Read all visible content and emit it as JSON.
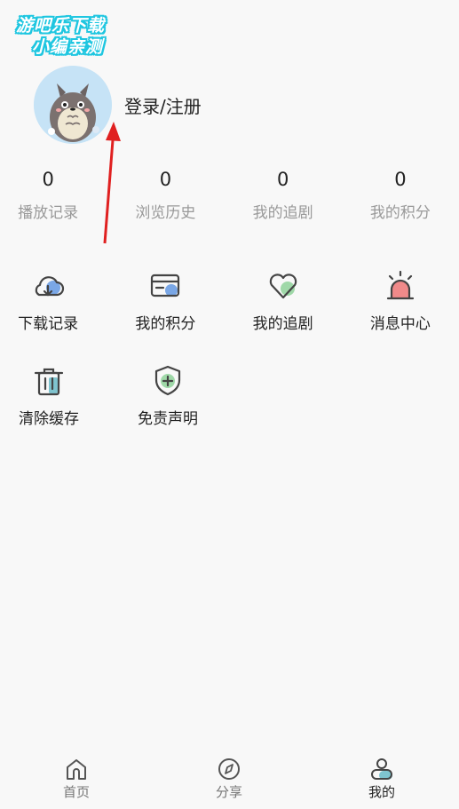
{
  "watermark": {
    "line1": "游吧乐下载",
    "line2": "小编亲测"
  },
  "profile": {
    "login_label": "登录/注册"
  },
  "stats": [
    {
      "value": "0",
      "label": "播放记录"
    },
    {
      "value": "0",
      "label": "浏览历史"
    },
    {
      "value": "0",
      "label": "我的追剧"
    },
    {
      "value": "0",
      "label": "我的积分"
    }
  ],
  "menu": [
    {
      "label": "下载记录",
      "icon": "cloud-download-icon"
    },
    {
      "label": "我的积分",
      "icon": "card-icon"
    },
    {
      "label": "我的追剧",
      "icon": "heart-icon"
    },
    {
      "label": "消息中心",
      "icon": "alarm-icon"
    },
    {
      "label": "清除缓存",
      "icon": "trash-icon"
    },
    {
      "label": "免责声明",
      "icon": "shield-icon"
    }
  ],
  "tabbar": [
    {
      "label": "首页",
      "icon": "home-icon"
    },
    {
      "label": "分享",
      "icon": "compass-icon"
    },
    {
      "label": "我的",
      "icon": "user-icon",
      "active": true
    }
  ],
  "colors": {
    "accent_blue": "#7aa7e6",
    "accent_green": "#9fd8a8",
    "accent_red": "#f08a8a",
    "arrow": "#e02020"
  }
}
